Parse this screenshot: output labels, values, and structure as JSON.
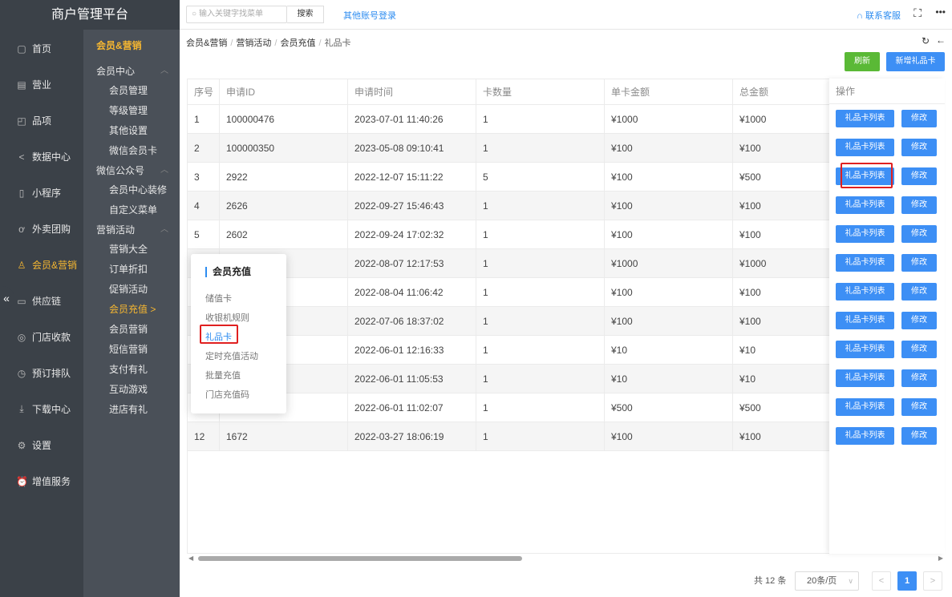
{
  "app": {
    "title": "商户管理平台"
  },
  "topbar": {
    "search_placeholder": "输入关键字找菜单",
    "search_button": "搜索",
    "other_login": "其他账号登录",
    "contact": "联系客服"
  },
  "nav_main": [
    {
      "label": "首页",
      "icon": "page-icon"
    },
    {
      "label": "营业",
      "icon": "calendar-icon"
    },
    {
      "label": "品项",
      "icon": "bag-icon"
    },
    {
      "label": "数据中心",
      "icon": "share-icon"
    },
    {
      "label": "小程序",
      "icon": "phone-icon"
    },
    {
      "label": "外卖团购",
      "icon": "bike-icon"
    },
    {
      "label": "会员&营销",
      "icon": "user-icon"
    },
    {
      "label": "供应链",
      "icon": "truck-icon"
    },
    {
      "label": "门店收款",
      "icon": "database-icon"
    },
    {
      "label": "预订排队",
      "icon": "clock-icon"
    },
    {
      "label": "下载中心",
      "icon": "download-icon"
    },
    {
      "label": "设置",
      "icon": "gear-icon"
    },
    {
      "label": "增值服务",
      "icon": "alarm-icon"
    }
  ],
  "nav_sub": {
    "title": "会员&营销",
    "groups": [
      {
        "label": "会员中心",
        "items": [
          "会员管理",
          "等级管理",
          "其他设置",
          "微信会员卡"
        ]
      },
      {
        "label": "微信公众号",
        "items": [
          "会员中心装修",
          "自定义菜单"
        ]
      },
      {
        "label": "营销活动",
        "items": [
          "营销大全",
          "订单折扣",
          "促销活动",
          "会员充值 >",
          "会员营销",
          "短信营销",
          "支付有礼",
          "互动游戏",
          "进店有礼"
        ]
      }
    ]
  },
  "breadcrumb": [
    "会员&营销",
    "营销活动",
    "会员充值",
    "礼品卡"
  ],
  "actions": {
    "refresh": "刷新",
    "add": "新增礼品卡"
  },
  "table": {
    "headers": [
      "序号",
      "申请ID",
      "申请时间",
      "卡数量",
      "单卡金额",
      "总金额",
      "操作"
    ],
    "rows": [
      [
        "1",
        "100000476",
        "2023-07-01 11:40:26",
        "1",
        "¥1000",
        "¥1000"
      ],
      [
        "2",
        "100000350",
        "2023-05-08 09:10:41",
        "1",
        "¥100",
        "¥100"
      ],
      [
        "3",
        "2922",
        "2022-12-07 15:11:22",
        "5",
        "¥100",
        "¥500"
      ],
      [
        "4",
        "2626",
        "2022-09-27 15:46:43",
        "1",
        "¥100",
        "¥100"
      ],
      [
        "5",
        "2602",
        "2022-09-24 17:02:32",
        "1",
        "¥100",
        "¥100"
      ],
      [
        "",
        "",
        "2022-08-07 12:17:53",
        "1",
        "¥1000",
        "¥1000"
      ],
      [
        "",
        "",
        "2022-08-04 11:06:42",
        "1",
        "¥100",
        "¥100"
      ],
      [
        "",
        "",
        "2022-07-06 18:37:02",
        "1",
        "¥100",
        "¥100"
      ],
      [
        "",
        "",
        "2022-06-01 12:16:33",
        "1",
        "¥10",
        "¥10"
      ],
      [
        "",
        "",
        "2022-06-01 11:05:53",
        "1",
        "¥10",
        "¥10"
      ],
      [
        "",
        "",
        "2022-06-01 11:02:07",
        "1",
        "¥500",
        "¥500"
      ],
      [
        "12",
        "1672",
        "2022-03-27 18:06:19",
        "1",
        "¥100",
        "¥100"
      ]
    ],
    "op_list_label": "礼品卡列表",
    "op_edit_label": "修改"
  },
  "pagination": {
    "total": "共 12 条",
    "page_size": "20条/页",
    "current": "1",
    "prev": "<",
    "next": ">"
  },
  "popup": {
    "title": "会员充值",
    "items": [
      "储值卡",
      "收银机规则",
      "礼品卡",
      "定时充值活动",
      "批量充值",
      "门店充值码"
    ],
    "active_index": 2
  },
  "colors": {
    "accent": "#3d8ff5",
    "active_nav": "#f6b731",
    "refresh": "#5ab936",
    "highlight": "#e02020"
  }
}
